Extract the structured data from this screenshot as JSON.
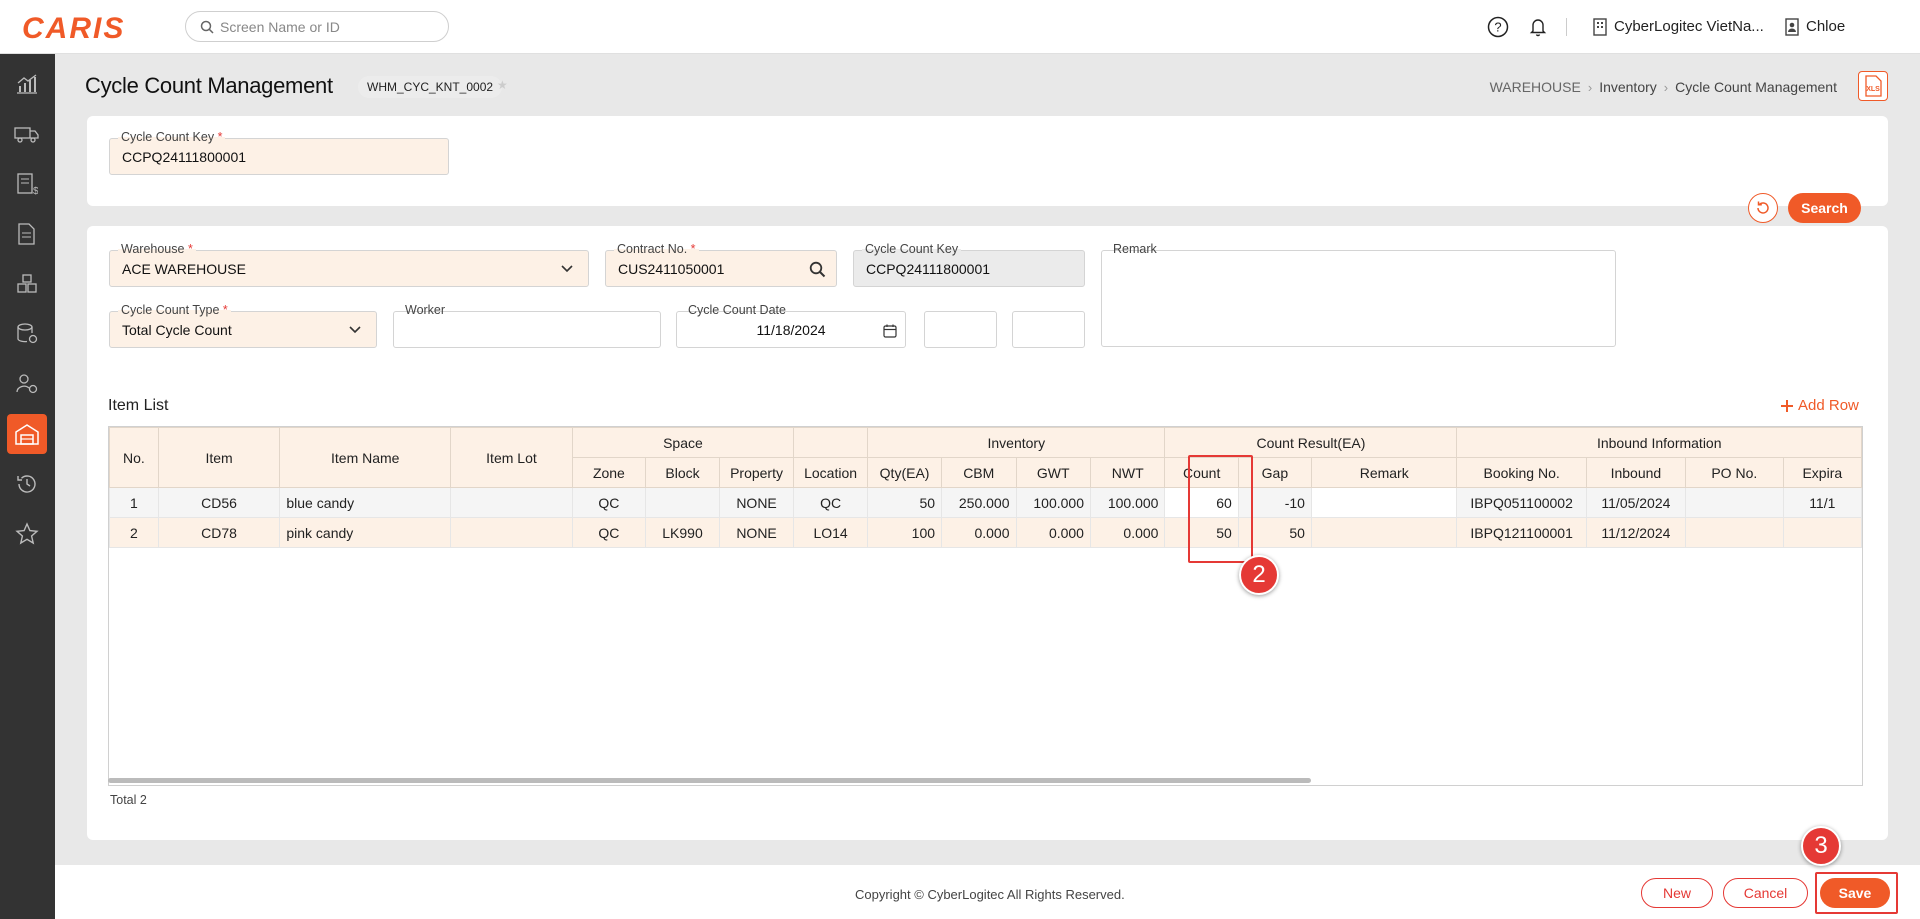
{
  "app": {
    "logo": "CARIS",
    "search_placeholder": "Screen Name or ID",
    "company": "CyberLogitec VietNa...",
    "user": "Chloe"
  },
  "page": {
    "title": "Cycle Count Management",
    "screen_id": "WHM_CYC_KNT_0002",
    "breadcrumb": [
      "WAREHOUSE",
      "Inventory",
      "Cycle Count Management"
    ],
    "xls_label": "XLS"
  },
  "search_panel": {
    "key_label": "Cycle Count Key",
    "key_value": "CCPQ24111800001",
    "search_button": "Search"
  },
  "detail": {
    "warehouse_label": "Warehouse",
    "warehouse_value": "ACE WAREHOUSE",
    "contract_label": "Contract No.",
    "contract_value": "CUS2411050001",
    "key_label": "Cycle Count Key",
    "key_value": "CCPQ24111800001",
    "remark_label": "Remark",
    "type_label": "Cycle Count Type",
    "type_value": "Total Cycle Count",
    "worker_label": "Worker",
    "worker_value": "",
    "date_label": "Cycle Count Date",
    "date_value": "11/18/2024"
  },
  "grid": {
    "title": "Item List",
    "add_row": "Add Row",
    "group_headers": {
      "space": "Space",
      "inventory": "Inventory",
      "count_result": "Count Result(EA)",
      "inbound": "Inbound Information"
    },
    "headers": {
      "no": "No.",
      "item": "Item",
      "item_name": "Item Name",
      "item_lot": "Item Lot",
      "zone": "Zone",
      "block": "Block",
      "property": "Property",
      "location": "Location",
      "qty": "Qty(EA)",
      "cbm": "CBM",
      "gwt": "GWT",
      "nwt": "NWT",
      "count": "Count",
      "gap": "Gap",
      "remark": "Remark",
      "booking": "Booking No.",
      "inbound": "Inbound",
      "po": "PO No.",
      "expira": "Expira"
    },
    "rows": [
      {
        "no": "1",
        "item": "CD56",
        "item_name": "blue candy",
        "item_lot": "",
        "zone": "QC",
        "block": "",
        "property": "NONE",
        "location": "QC",
        "qty": "50",
        "cbm": "250.000",
        "gwt": "100.000",
        "nwt": "100.000",
        "count": "60",
        "gap": "-10",
        "remark": "",
        "booking": "IBPQ051100002",
        "inbound": "11/05/2024",
        "po": "",
        "expira": "11/1"
      },
      {
        "no": "2",
        "item": "CD78",
        "item_name": "pink candy",
        "item_lot": "",
        "zone": "QC",
        "block": "LK990",
        "property": "NONE",
        "location": "LO14",
        "qty": "100",
        "cbm": "0.000",
        "gwt": "0.000",
        "nwt": "0.000",
        "count": "50",
        "gap": "50",
        "remark": "",
        "booking": "IBPQ121100001",
        "inbound": "11/12/2024",
        "po": "",
        "expira": ""
      }
    ],
    "total": "Total 2"
  },
  "callouts": {
    "step2": "2",
    "step3": "3"
  },
  "footer": {
    "copyright": "Copyright © CyberLogitec All Rights Reserved.",
    "new": "New",
    "cancel": "Cancel",
    "save": "Save"
  },
  "colors": {
    "accent": "#f05a28",
    "required_bg": "#fdf1e6",
    "callout": "#e53935",
    "sidebar": "#333333"
  }
}
